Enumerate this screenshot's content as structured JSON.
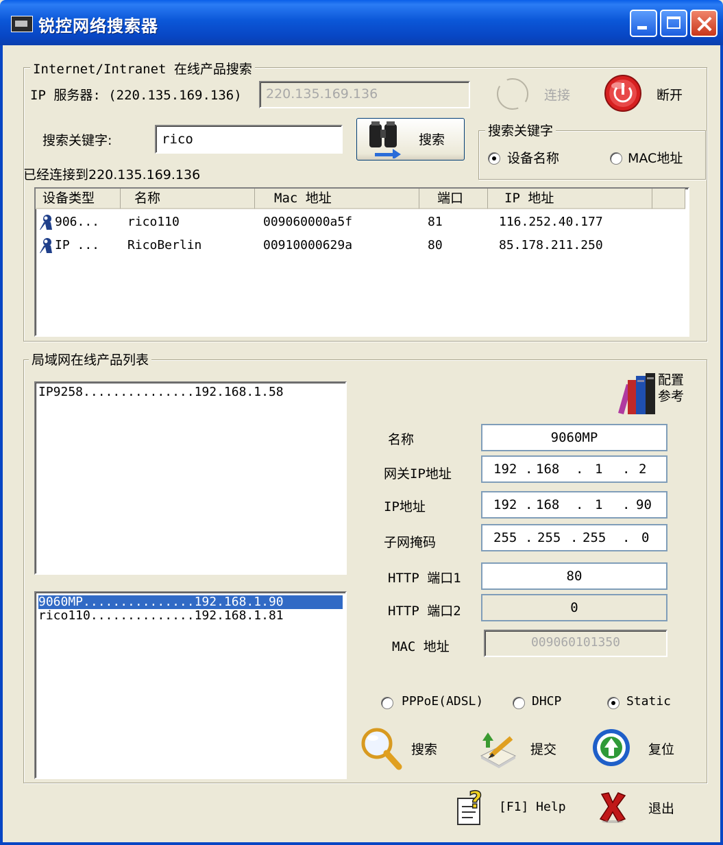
{
  "window": {
    "title": "锐控网络搜索器"
  },
  "internet": {
    "group_label": "Internet/Intranet 在线产品搜索",
    "server_label": "IP 服务器: (220.135.169.136)",
    "server_value": "220.135.169.136",
    "connect_label": "连接",
    "disconnect_label": "断开",
    "keyword_label": "搜索关键字:",
    "keyword_value": "rico",
    "search_label": "搜索",
    "status": "已经连接到220.135.169.136",
    "keyword_group": {
      "label": "搜索关键字",
      "options": [
        "设备名称",
        "MAC地址"
      ],
      "selected": "设备名称"
    },
    "table": {
      "columns": [
        "设备类型",
        "名称",
        "Mac 地址",
        "端口",
        "IP 地址"
      ],
      "rows": [
        {
          "type": "906...",
          "name": "rico110",
          "mac": "009060000a5f",
          "port": "81",
          "ip": "116.252.40.177"
        },
        {
          "type": "IP ...",
          "name": "RicoBerlin",
          "mac": "00910000629a",
          "port": "80",
          "ip": "85.178.211.250"
        }
      ]
    }
  },
  "lan": {
    "group_label": "局域网在线产品列表",
    "list1": [
      "IP9258...............192.168.1.58"
    ],
    "list2": [
      {
        "text": "9060MP...............192.168.1.90",
        "selected": true
      },
      {
        "text": "rico110..............192.168.1.81",
        "selected": false
      }
    ],
    "config_ref": [
      "配置",
      "参考"
    ],
    "fields": {
      "name": {
        "label": "名称",
        "value": "9060MP"
      },
      "gateway": {
        "label": "网关IP地址",
        "octets": [
          "192",
          "168",
          "1",
          "2"
        ]
      },
      "ip": {
        "label": "IP地址",
        "octets": [
          "192",
          "168",
          "1",
          "90"
        ]
      },
      "mask": {
        "label": "子网掩码",
        "octets": [
          "255",
          "255",
          "255",
          "0"
        ]
      },
      "http1": {
        "label": "HTTP 端口1",
        "value": "80"
      },
      "http2": {
        "label": "HTTP 端口2",
        "value": "0"
      },
      "mac": {
        "label": "MAC 地址",
        "value": "009060101350"
      }
    },
    "modes": {
      "options": [
        "PPPoE(ADSL)",
        "DHCP",
        "Static"
      ],
      "selected": "Static"
    },
    "search_label": "搜索",
    "submit_label": "提交",
    "reset_label": "复位"
  },
  "footer": {
    "help_label": "[F1] Help",
    "exit_label": "退出"
  }
}
